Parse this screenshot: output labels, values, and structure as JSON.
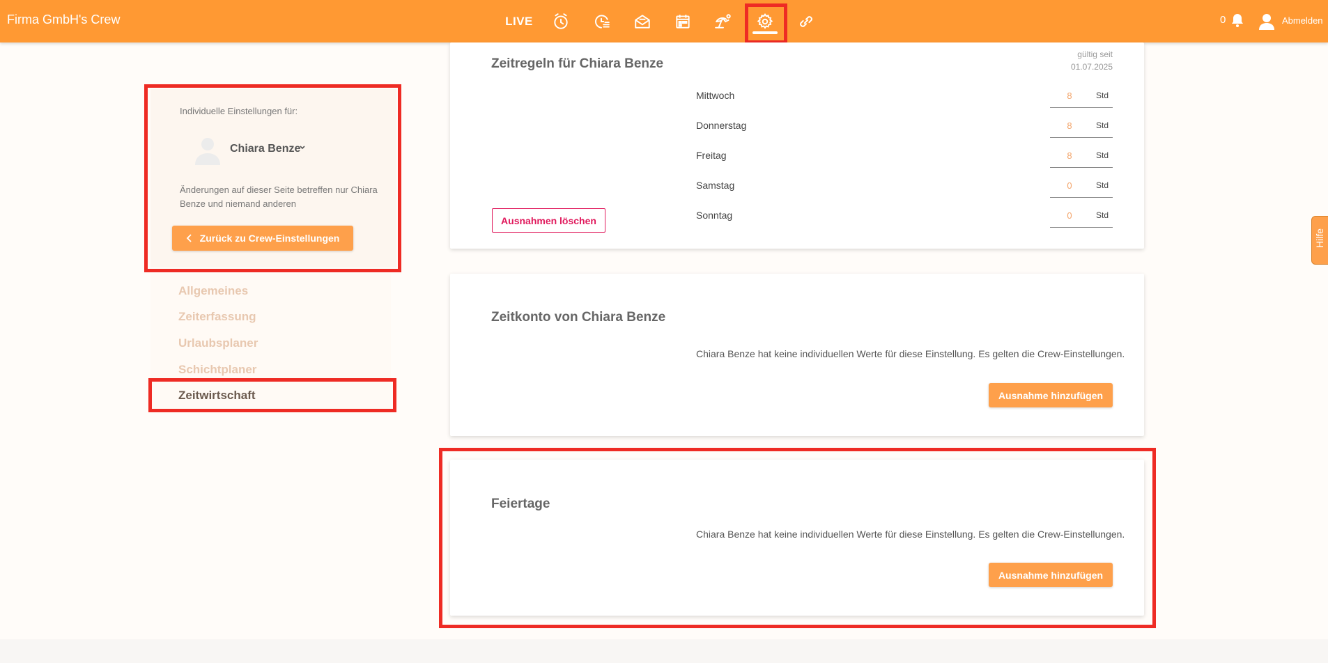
{
  "header": {
    "brand": "Firma GmbH's Crew",
    "nav": [
      {
        "name": "live",
        "label": "LIVE"
      },
      {
        "name": "stopwatch-icon"
      },
      {
        "name": "timesheet-icon"
      },
      {
        "name": "inbox-icon"
      },
      {
        "name": "calendar-icon"
      },
      {
        "name": "vacation-icon"
      },
      {
        "name": "gear-icon",
        "active": true
      },
      {
        "name": "link-icon"
      }
    ],
    "notification_count": "0",
    "logout_label": "Abmelden"
  },
  "sidebar": {
    "individual_label": "Individuelle Einstellungen für:",
    "user_name": "Chiara Benze",
    "changes_note": "Änderungen auf dieser Seite betreffen nur Chiara Benze und niemand anderen",
    "back_button": "Zurück zu Crew-Einstellungen",
    "menu": [
      {
        "label": "Allgemeines",
        "active": false
      },
      {
        "label": "Zeiterfassung",
        "active": false
      },
      {
        "label": "Urlaubsplaner",
        "active": false
      },
      {
        "label": "Schichtplaner",
        "active": false
      },
      {
        "label": "Zeitwirtschaft",
        "active": true
      }
    ]
  },
  "time_rules": {
    "title": "Zeitregeln für Chiara Benze",
    "valid_since_label": "gültig seit",
    "valid_since_date": "01.07.2025",
    "days": [
      {
        "day": "Mittwoch",
        "hours": "8",
        "unit": "Std"
      },
      {
        "day": "Donnerstag",
        "hours": "8",
        "unit": "Std"
      },
      {
        "day": "Freitag",
        "hours": "8",
        "unit": "Std"
      },
      {
        "day": "Samstag",
        "hours": "0",
        "unit": "Std"
      },
      {
        "day": "Sonntag",
        "hours": "0",
        "unit": "Std"
      }
    ],
    "delete_button": "Ausnahmen löschen"
  },
  "time_account": {
    "title": "Zeitkonto von Chiara Benze",
    "info": "Chiara Benze hat keine individuellen Werte für diese Einstellung. Es gelten die Crew-Einstellungen.",
    "add_button": "Ausnahme hinzufügen"
  },
  "holidays": {
    "title": "Feiertage",
    "info": "Chiara Benze hat keine individuellen Werte für diese Einstellung. Es gelten die Crew-Einstellungen.",
    "add_button": "Ausnahme hinzufügen"
  },
  "help_tab": "Hilfe",
  "colors": {
    "brand": "#ff9933",
    "button": "#fea04b",
    "danger": "#e0195c",
    "highlight": "#ee2b24"
  }
}
